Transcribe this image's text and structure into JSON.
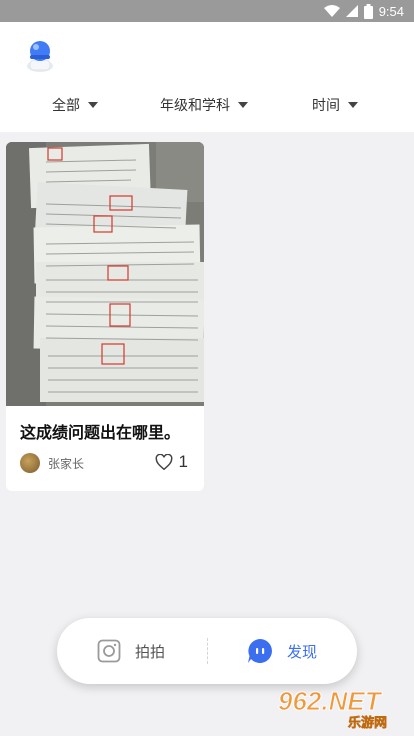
{
  "status_bar": {
    "time": "9:54"
  },
  "filters": [
    {
      "label": "全部"
    },
    {
      "label": "年级和学科"
    },
    {
      "label": "时间"
    }
  ],
  "post": {
    "title": "这成绩问题出在哪里。",
    "author": "张家长",
    "likes": "1"
  },
  "tabs": [
    {
      "label": "拍拍",
      "icon": "camera-icon",
      "color": "#555555"
    },
    {
      "label": "发现",
      "icon": "discover-icon",
      "color": "#3c6ff0"
    }
  ],
  "watermark": {
    "text": "962.NET",
    "subtitle": "乐游网"
  },
  "colors": {
    "accent": "#3c6ff0",
    "watermark": "#f08a1c"
  }
}
